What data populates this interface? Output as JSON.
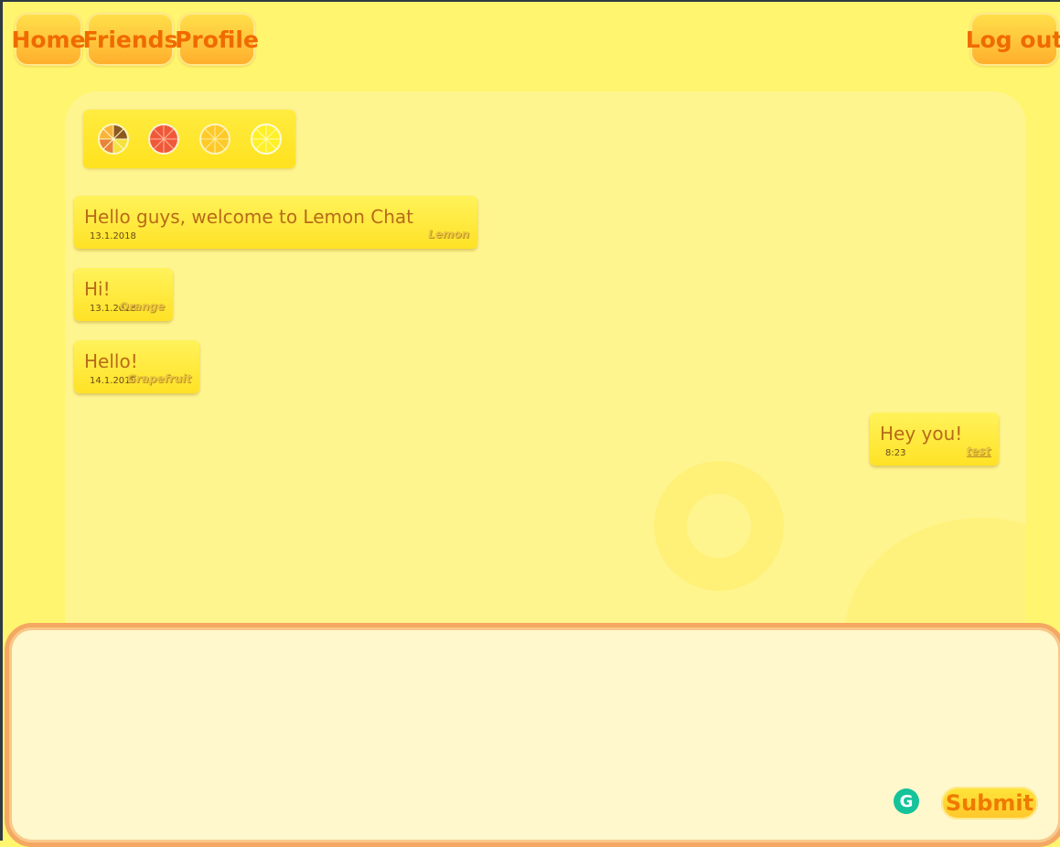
{
  "nav": {
    "home_label": "Home",
    "friends_label": "Friends",
    "profile_label": "Profile",
    "logout_label": "Log out"
  },
  "themes": [
    {
      "icon": "mixed-fruit-icon",
      "color": "#f4b43a"
    },
    {
      "icon": "grapefruit-icon",
      "color": "#f0583a"
    },
    {
      "icon": "orange-icon",
      "color": "#ffcf2a"
    },
    {
      "icon": "lemon-icon",
      "color": "#fff028"
    }
  ],
  "messages": [
    {
      "text": "Hello guys, welcome to Lemon Chat",
      "date": "13.1.2018",
      "author": "Lemon",
      "own": false
    },
    {
      "text": "Hi!",
      "date": "13.1.2018",
      "author": "Orange",
      "own": false
    },
    {
      "text": "Hello!",
      "date": "14.1.2018",
      "author": "Grapefruit",
      "own": false
    },
    {
      "text": "Hey you!",
      "date": "8:23",
      "author": "test",
      "own": true
    }
  ],
  "composer": {
    "value": "",
    "submit_label": "Submit",
    "grammarly_glyph": "G"
  },
  "colors": {
    "background": "#fff56e",
    "panel": "#fff58f",
    "button_text": "#f06a00",
    "composer_border": "#f4a862"
  }
}
